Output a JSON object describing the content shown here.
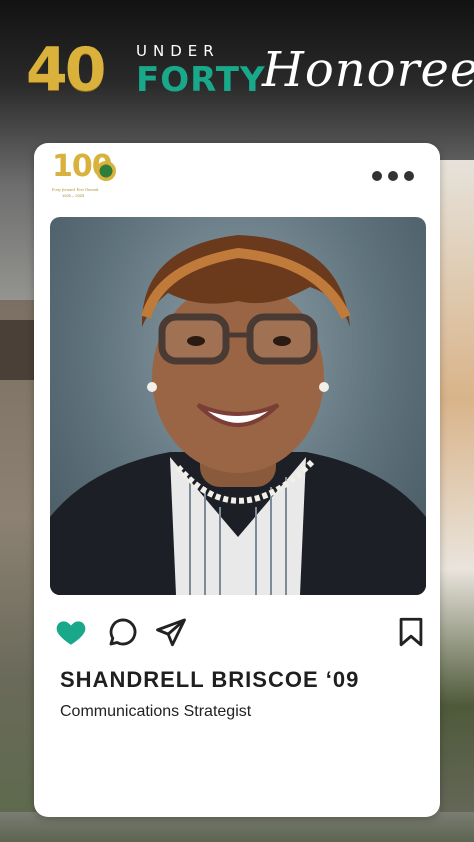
{
  "header": {
    "logo_number": "40",
    "logo_under": "UNDER",
    "logo_forty": "FORTY",
    "title": "Honoree"
  },
  "badge": {
    "number": "100",
    "tagline": "Forty forward. Ever Onward.",
    "years": "1925 – 2025"
  },
  "post": {
    "name": "SHANDRELL BRISCOE ‘09",
    "role": "Communications Strategist",
    "liked": true
  },
  "icons": {
    "more": "more-dots-icon",
    "like": "heart-icon",
    "comment": "comment-icon",
    "share": "send-icon",
    "save": "bookmark-icon"
  },
  "colors": {
    "gold": "#d9b13b",
    "teal": "#1aa88b",
    "like_green": "#19a88a",
    "text": "#1f1f1f"
  }
}
